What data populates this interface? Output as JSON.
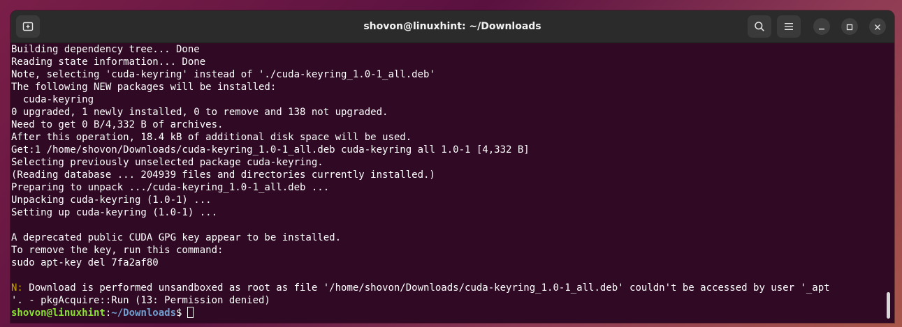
{
  "window": {
    "title": "shovon@linuxhint: ~/Downloads"
  },
  "header": {
    "new_tab_icon": "new-tab-icon",
    "search_icon": "search-icon",
    "menu_icon": "hamburger-menu-icon",
    "minimize_icon": "minimize-icon",
    "maximize_icon": "maximize-icon",
    "close_icon": "close-icon"
  },
  "colors": {
    "terminal_bg": "#300a24",
    "text": "#ffffff",
    "note_prefix": "#c4a000",
    "prompt_user": "#8ae234",
    "prompt_path": "#729fcf"
  },
  "terminal": {
    "lines": [
      "Building dependency tree... Done",
      "Reading state information... Done",
      "Note, selecting 'cuda-keyring' instead of './cuda-keyring_1.0-1_all.deb'",
      "The following NEW packages will be installed:",
      "  cuda-keyring",
      "0 upgraded, 1 newly installed, 0 to remove and 138 not upgraded.",
      "Need to get 0 B/4,332 B of archives.",
      "After this operation, 18.4 kB of additional disk space will be used.",
      "Get:1 /home/shovon/Downloads/cuda-keyring_1.0-1_all.deb cuda-keyring all 1.0-1 [4,332 B]",
      "Selecting previously unselected package cuda-keyring.",
      "(Reading database ... 204939 files and directories currently installed.)",
      "Preparing to unpack .../cuda-keyring_1.0-1_all.deb ...",
      "Unpacking cuda-keyring (1.0-1) ...",
      "Setting up cuda-keyring (1.0-1) ...",
      "",
      "A deprecated public CUDA GPG key appear to be installed.",
      "To remove the key, run this command:",
      "sudo apt-key del 7fa2af80",
      ""
    ],
    "note": {
      "prefix": "N:",
      "line1": " Download is performed unsandboxed as root as file '/home/shovon/Downloads/cuda-keyring_1.0-1_all.deb' couldn't be accessed by user '_apt",
      "line2": "'. - pkgAcquire::Run (13: Permission denied)"
    },
    "prompt": {
      "user_host": "shovon@linuxhint",
      "separator": ":",
      "path": "~/Downloads",
      "symbol": "$"
    }
  }
}
